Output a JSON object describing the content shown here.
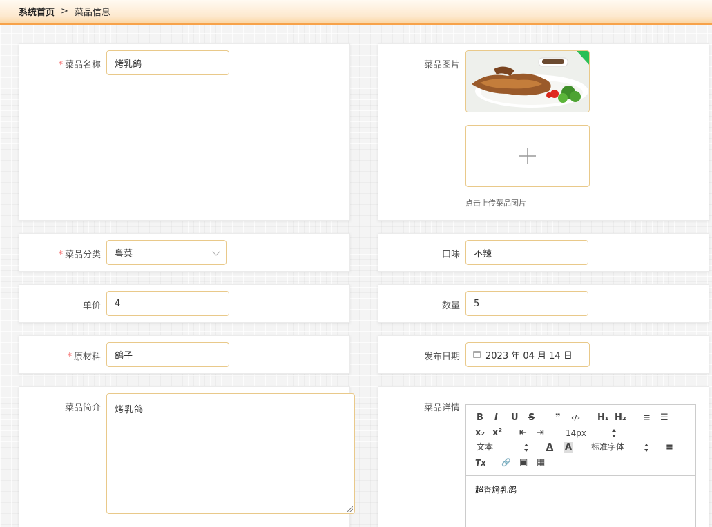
{
  "breadcrumb": {
    "home": "系统首页",
    "separator": ">",
    "current": "菜品信息"
  },
  "form": {
    "name": {
      "label": "菜品名称",
      "required": "*",
      "value": "烤乳鸽"
    },
    "image": {
      "label": "菜品图片",
      "upload_tip": "点击上传菜品图片"
    },
    "category": {
      "label": "菜品分类",
      "required": "*",
      "value": "粤菜"
    },
    "taste": {
      "label": "口味",
      "value": "不辣"
    },
    "price": {
      "label": "单价",
      "value": "4"
    },
    "quantity": {
      "label": "数量",
      "value": "5"
    },
    "ingredients": {
      "label": "原材料",
      "required": "*",
      "value": "鸽子"
    },
    "publish_date": {
      "label": "发布日期",
      "value": "2023 年 04 月 14 日"
    },
    "intro": {
      "label": "菜品简介",
      "value": "烤乳鸽"
    },
    "detail": {
      "label": "菜品详情",
      "content": "超香烤乳鸽",
      "toolbar": {
        "bold": "B",
        "italic": "I",
        "underline": "U",
        "strike": "S",
        "blockquote": "❞",
        "code": "‹/›",
        "h1": "H₁",
        "h2": "H₂",
        "ordered_list": "≡",
        "bullet_list": "☰",
        "subscript": "x₂",
        "superscript": "x²",
        "outdent": "⇤",
        "indent": "⇥",
        "font_size": "14px",
        "header_select": "文本",
        "font_color": "A",
        "background_color": "A",
        "font_family": "标准字体",
        "align": "≡",
        "clean": "Tx",
        "link": "🔗",
        "image": "▣",
        "video": "▦"
      }
    }
  },
  "colors": {
    "accent_border": "#e9c98a",
    "topbar_line": "#f7a24a",
    "required": "#f56c6c"
  }
}
